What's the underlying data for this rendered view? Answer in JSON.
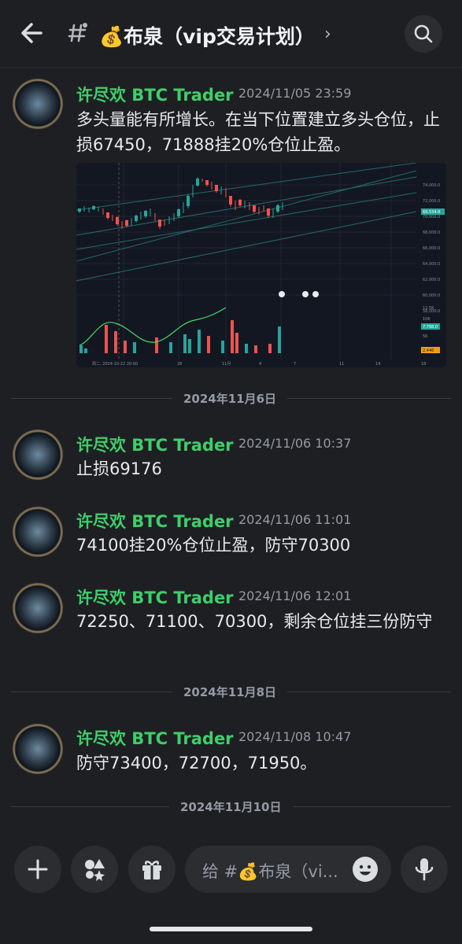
{
  "header": {
    "channel_title": "💰布泉（vip交易计划）",
    "chevron": "›",
    "icons": [
      "back-arrow-icon",
      "channel-hash-icon",
      "search-icon"
    ]
  },
  "messages": [
    {
      "author": "许尽欢 BTC Trader",
      "timestamp": "2024/11/05 23:59",
      "content": "多头量能有所增长。在当下位置建立多头仓位，止损67450，71888挂20%仓位止盈。"
    },
    {
      "author": "许尽欢 BTC Trader",
      "timestamp": "2024/11/06 10:37",
      "content": "止损69176"
    },
    {
      "author": "许尽欢 BTC Trader",
      "timestamp": "2024/11/06 11:01",
      "content": "74100挂20%仓位止盈，防守70300"
    },
    {
      "author": "许尽欢 BTC Trader",
      "timestamp": "2024/11/06 12:01",
      "content": "72250、71100、70300，剩余仓位挂三份防守"
    },
    {
      "author": "许尽欢 BTC Trader",
      "timestamp": "2024/11/08 10:47",
      "content": "防守73400，72700，71950。"
    }
  ],
  "dividers": [
    "2024年11月6日",
    "2024年11月8日",
    "2024年11月10日"
  ],
  "chart": {
    "price_labels": [
      "74,000.0",
      "72,000.0",
      "70,000.0",
      "68,000.0",
      "66,000.0",
      "64,000.0",
      "62,000.0",
      "60,000.0",
      "58,000.0"
    ],
    "current_price": "69,534.8",
    "volume_labels": [
      "12.5K",
      "10K",
      "5K"
    ],
    "volume_badge": "7,798.0",
    "indicator_badge": "2,446",
    "x_labels": [
      "周二, 2024-10-22 20:00",
      "28",
      "11月",
      "4",
      "7",
      "11",
      "14",
      "18"
    ],
    "accent_up": "#26a69a",
    "accent_down": "#ef5350"
  },
  "composer": {
    "placeholder": "给 #💰布泉（vi...",
    "icons": [
      "plus-icon",
      "apps-icon",
      "gift-icon",
      "emoji-icon",
      "microphone-icon"
    ]
  },
  "colors": {
    "background": "#1e1f22",
    "author": "#3ecf6b",
    "muted": "#949ba4"
  }
}
